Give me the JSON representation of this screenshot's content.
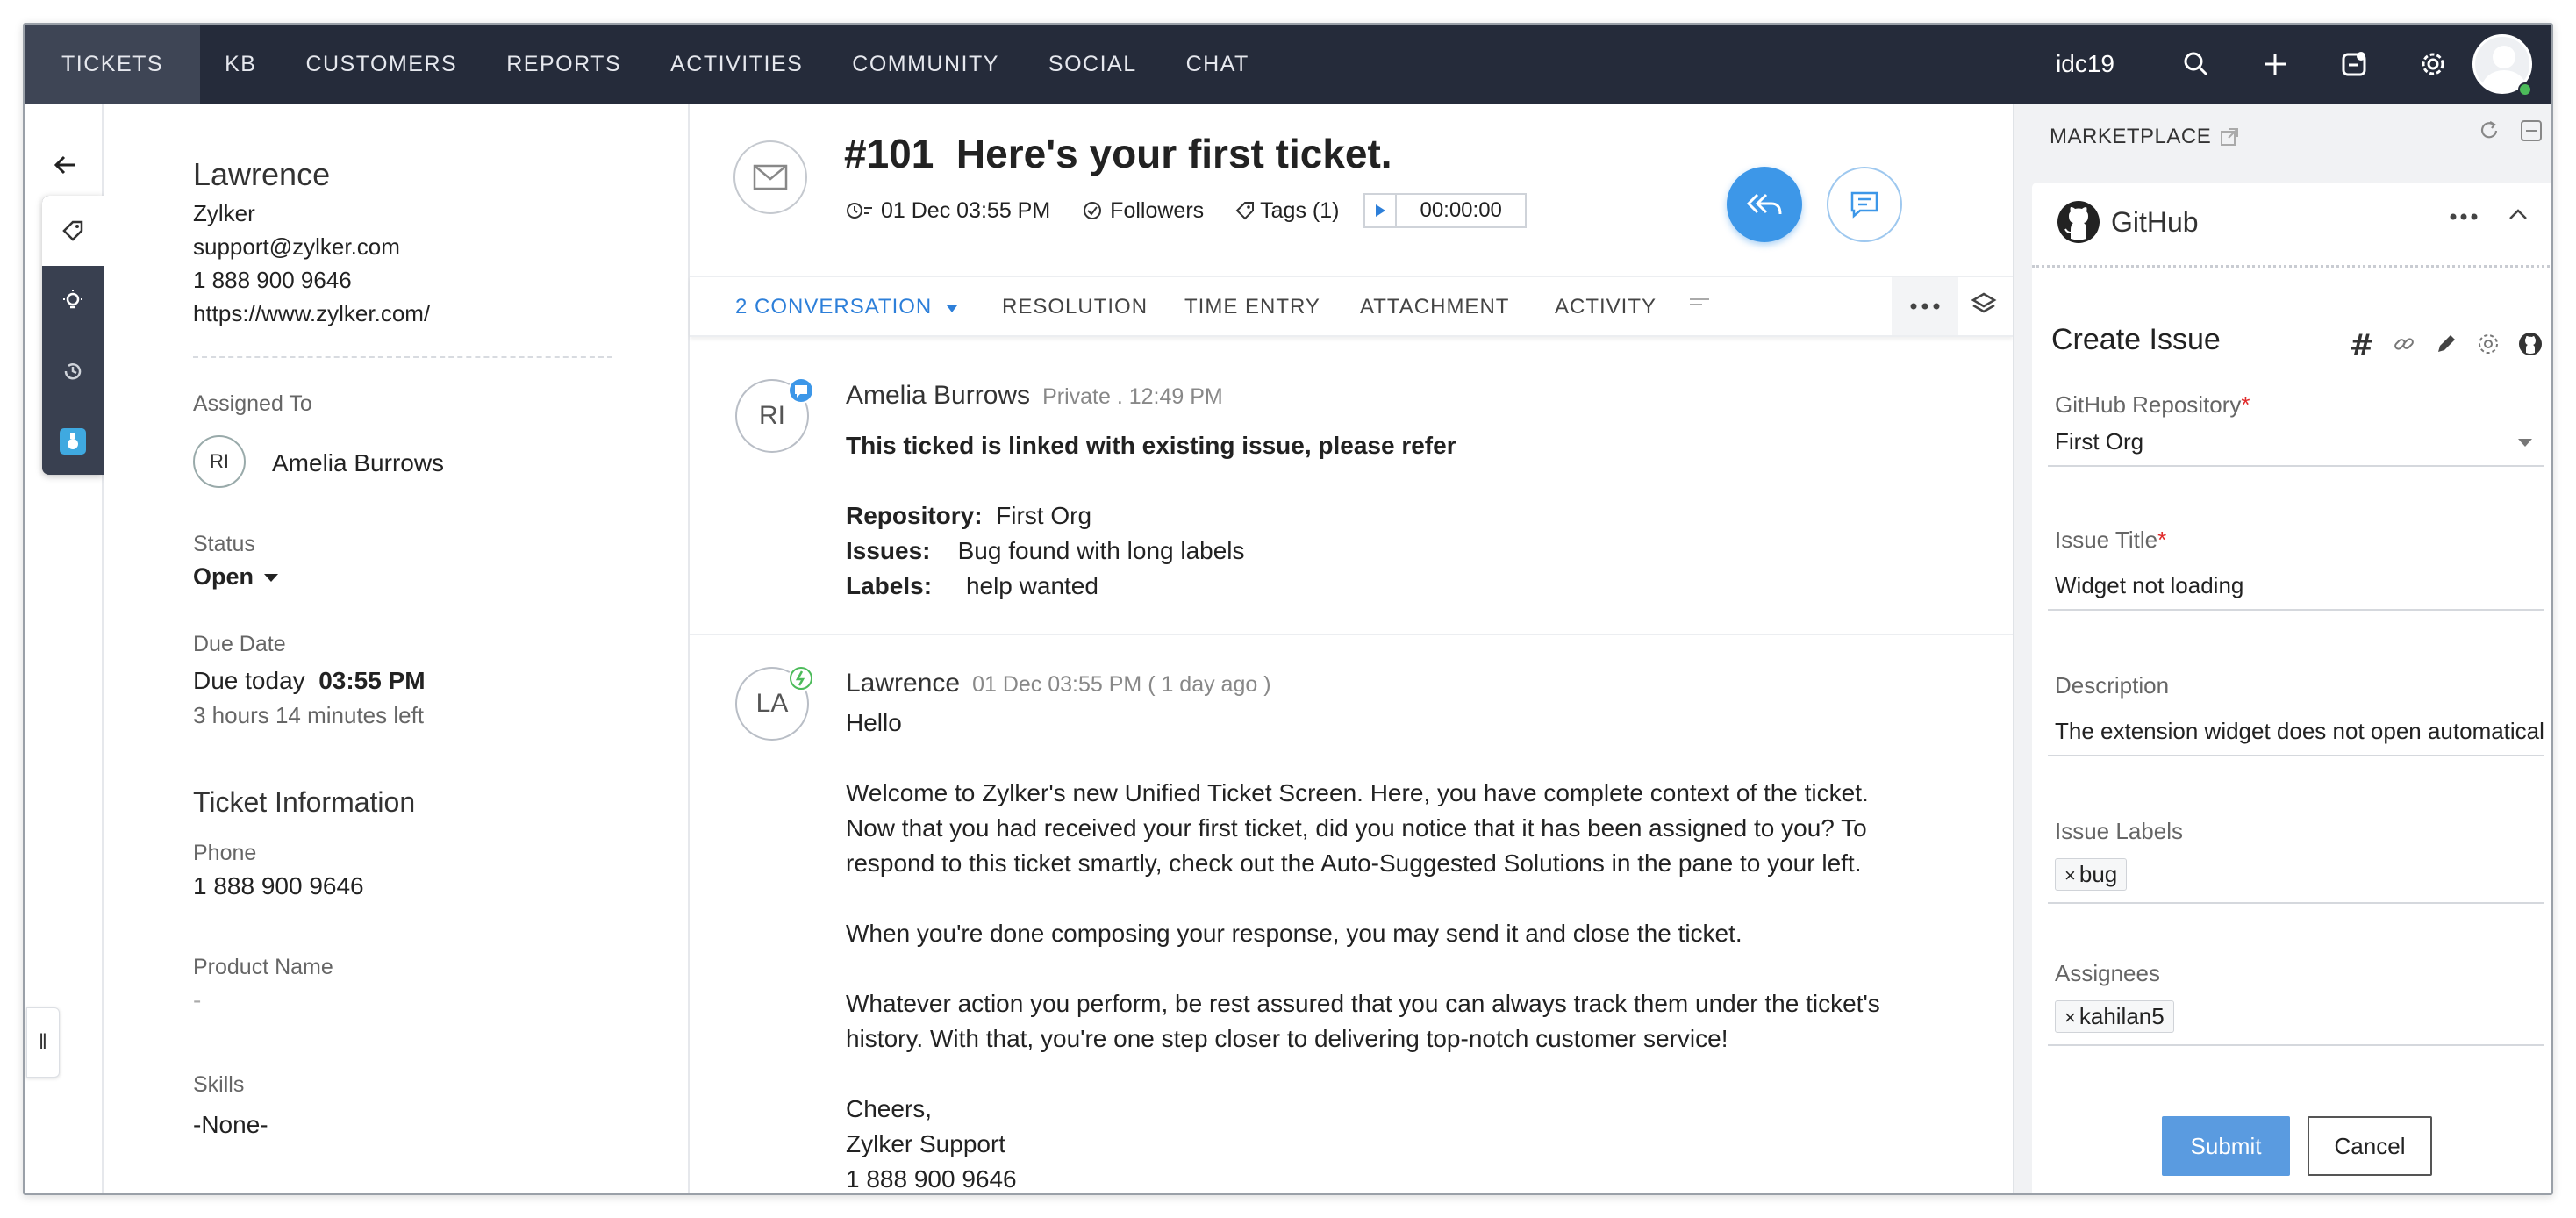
{
  "nav": {
    "tabs": [
      "TICKETS",
      "KB",
      "CUSTOMERS",
      "REPORTS",
      "ACTIVITIES",
      "COMMUNITY",
      "SOCIAL",
      "CHAT"
    ],
    "org": "idc19"
  },
  "contact": {
    "name": "Lawrence",
    "company": "Zylker",
    "email": "support@zylker.com",
    "phone": "1 888 900 9646",
    "website": "https://www.zylker.com/",
    "assigned_label": "Assigned To",
    "assignee_initials": "RI",
    "assignee_name": "Amelia Burrows",
    "status_label": "Status",
    "status_value": "Open",
    "due_label": "Due Date",
    "due_prefix": "Due today",
    "due_time": "03:55 PM",
    "due_left": "3 hours 14 minutes left",
    "info_heading": "Ticket Information",
    "phone_label": "Phone",
    "phone_value": "1 888 900 9646",
    "product_label": "Product Name",
    "product_value": "-",
    "skills_label": "Skills",
    "skills_value": "-None-"
  },
  "ticket": {
    "number": "#101",
    "subject": "Here's your first ticket.",
    "date": "01 Dec 03:55 PM",
    "followers": "Followers",
    "tags": "Tags (1)",
    "timer": "00:00:00"
  },
  "tabs": {
    "conversation": "2  CONVERSATION",
    "resolution": "RESOLUTION",
    "time_entry": "TIME ENTRY",
    "attachment": "ATTACHMENT",
    "activity": "ACTIVITY"
  },
  "threads": [
    {
      "initials": "RI",
      "author": "Amelia Burrows",
      "meta": "Private . 12:49 PM",
      "headline": "This ticked is linked with existing issue, please refer",
      "repo_label": "Repository:",
      "repo_value": "First Org",
      "issues_label": "Issues:",
      "issues_value": "Bug found with long labels",
      "labels_label": "Labels:",
      "labels_value": "help wanted"
    },
    {
      "initials": "LA",
      "author": "Lawrence",
      "meta": "01 Dec 03:55 PM ( 1 day ago )",
      "lines": [
        "Hello",
        "",
        "Welcome to Zylker's new Unified Ticket Screen. Here, you have complete context of the ticket.",
        "Now that you had received your first ticket, did you notice that it has been assigned to you? To",
        "respond to this ticket smartly, check out the Auto-Suggested Solutions in the pane to your left.",
        "",
        "When you're done composing your response, you may send it and close the ticket.",
        "",
        "Whatever action you perform, be rest assured that you can always track them under the ticket's",
        "history. With that, you're one step closer to delivering top-notch customer service!",
        "",
        "Cheers,",
        "Zylker Support",
        "1 888 900 9646"
      ]
    }
  ],
  "marketplace": {
    "title": "MARKETPLACE",
    "app": "GitHub",
    "form_title": "Create Issue",
    "repo_label": "GitHub Repository",
    "repo_value": "First Org",
    "issue_title_label": "Issue Title",
    "issue_title_value": "Widget not loading",
    "description_label": "Description",
    "description_value": "The extension widget does not open automatically",
    "labels_label": "Issue Labels",
    "label_tag": "bug",
    "assignees_label": "Assignees",
    "assignee_tag": "kahilan5",
    "submit": "Submit",
    "cancel": "Cancel",
    "required_mark": "*",
    "remove_mark": "×"
  }
}
